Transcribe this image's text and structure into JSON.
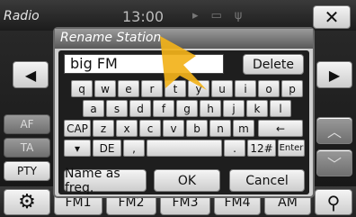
{
  "statusbar": {
    "title": "Radio",
    "time": "13:00",
    "close_label": "✕"
  },
  "side": {
    "left_arrow": "◀",
    "right_arrow": "▶",
    "af": "AF",
    "ta": "TA",
    "pty": "PTY",
    "up_icon": "chevron-up-icon",
    "down_icon": "chevron-down-icon"
  },
  "bottom": {
    "tabs": [
      "FM1",
      "FM2",
      "FM3",
      "FM4",
      "AM"
    ],
    "settings_icon": "gear-icon",
    "search_icon": "search-icon"
  },
  "dialog": {
    "title": "Rename Station",
    "input_value": "big FM",
    "delete_label": "Delete",
    "keyboard": {
      "row1": [
        "q",
        "w",
        "e",
        "r",
        "t",
        "y",
        "u",
        "i",
        "o",
        "p"
      ],
      "row2": [
        "a",
        "s",
        "d",
        "f",
        "g",
        "h",
        "j",
        "k",
        "l"
      ],
      "row3": [
        "CAP",
        "z",
        "x",
        "c",
        "v",
        "b",
        "n",
        "m",
        "←"
      ],
      "row4": [
        "▾",
        "DE",
        ",",
        "",
        ".",
        "12#",
        "Enter"
      ]
    },
    "name_as_freq_label": "Name as freq.",
    "ok_label": "OK",
    "cancel_label": "Cancel"
  },
  "colors": {
    "pointer": "#f2b21a",
    "dialog_bg": "#1e1e1e",
    "key_bg": "#e6e6e6"
  }
}
